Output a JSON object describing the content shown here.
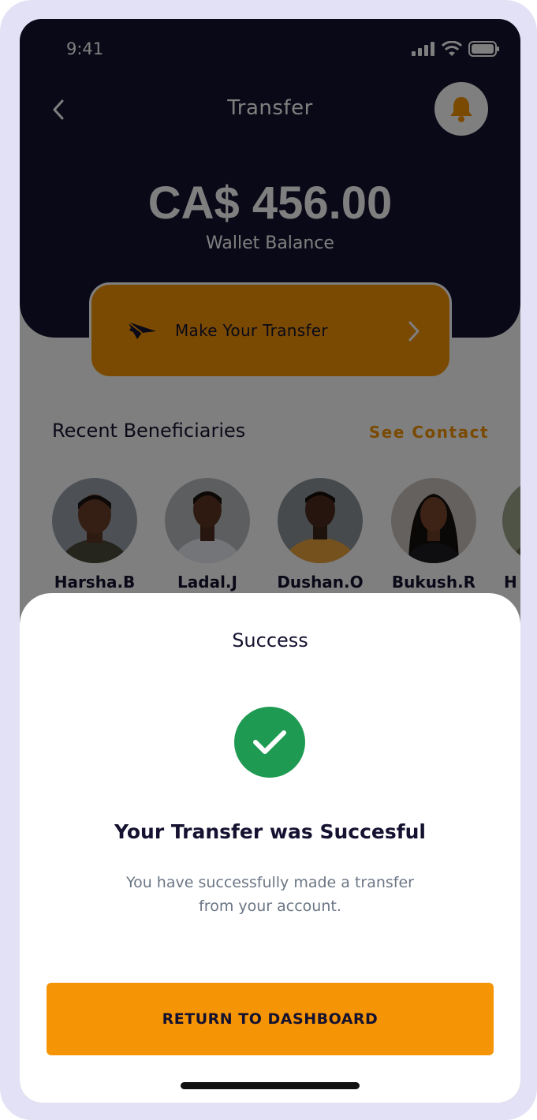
{
  "status_bar": {
    "time": "9:41"
  },
  "header": {
    "title": "Transfer",
    "back_icon": "chevron-left-icon",
    "notification_icon": "bell-icon",
    "balance_amount": "CA$ 456.00",
    "balance_label": "Wallet Balance"
  },
  "transfer_action": {
    "label": "Make Your Transfer"
  },
  "recent": {
    "title": "Recent Beneficiaries",
    "see_contact": "See Contact",
    "beneficiaries": [
      {
        "name": "Harsha.B"
      },
      {
        "name": "Ladal.J"
      },
      {
        "name": "Dushan.O"
      },
      {
        "name": "Bukush.R"
      },
      {
        "name": "H"
      }
    ]
  },
  "success_sheet": {
    "title": "Success",
    "heading": "Your Transfer was Succesful",
    "message": "You have successfully made a transfer from your account.",
    "button_label": "RETURN TO DASHBOARD"
  },
  "colors": {
    "header_bg": "#141230",
    "accent": "#f59405",
    "success": "#1f9a52",
    "frame": "#e3e1f5"
  }
}
